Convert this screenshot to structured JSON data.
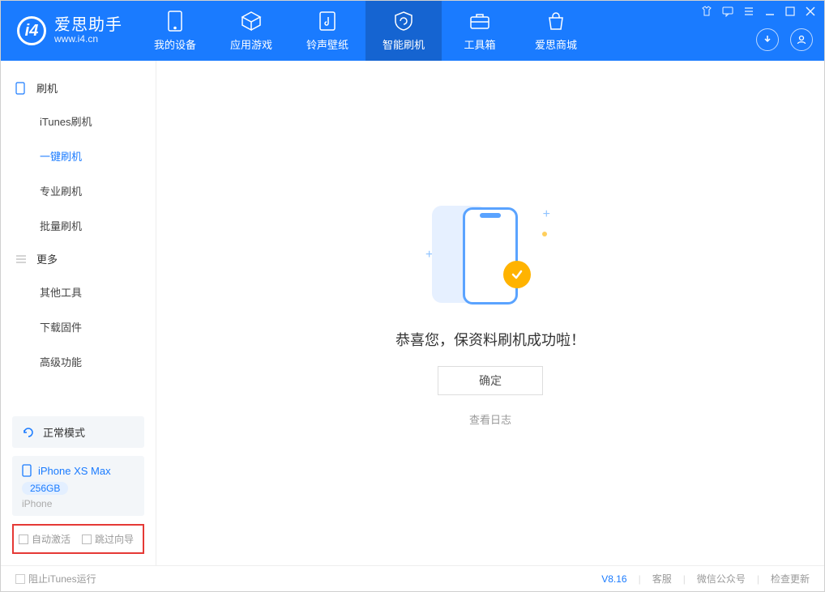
{
  "app": {
    "name_cn": "爱思助手",
    "name_en": "www.i4.cn"
  },
  "nav": {
    "items": [
      {
        "label": "我的设备"
      },
      {
        "label": "应用游戏"
      },
      {
        "label": "铃声壁纸"
      },
      {
        "label": "智能刷机"
      },
      {
        "label": "工具箱"
      },
      {
        "label": "爱思商城"
      }
    ]
  },
  "sidebar": {
    "group1": {
      "title": "刷机",
      "items": [
        "iTunes刷机",
        "一键刷机",
        "专业刷机",
        "批量刷机"
      ]
    },
    "group2": {
      "title": "更多",
      "items": [
        "其他工具",
        "下载固件",
        "高级功能"
      ]
    },
    "mode": {
      "label": "正常模式"
    },
    "device": {
      "name": "iPhone XS Max",
      "storage": "256GB",
      "platform": "iPhone"
    },
    "bottom_checks": {
      "auto_activate": "自动激活",
      "skip_guide": "跳过向导"
    }
  },
  "main": {
    "success": "恭喜您，保资料刷机成功啦！",
    "ok": "确定",
    "view_log": "查看日志"
  },
  "footer": {
    "block_itunes": "阻止iTunes运行",
    "version": "V8.16",
    "support": "客服",
    "wechat": "微信公众号",
    "check_update": "检查更新"
  }
}
